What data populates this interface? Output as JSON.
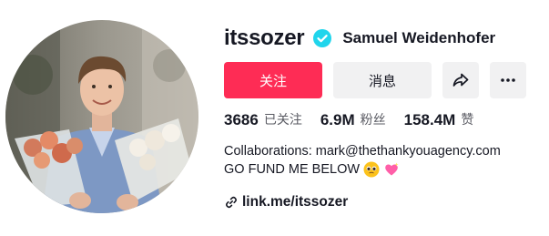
{
  "profile": {
    "username": "itssozer",
    "nickname": "Samuel Weidenhofer",
    "verified_icon": "verified-badge-icon",
    "avatar_icon": "profile-photo"
  },
  "buttons": {
    "follow_label": "关注",
    "message_label": "消息",
    "share_icon": "share-arrow-icon",
    "more_icon": "more-dots-icon"
  },
  "stats": {
    "following_count": "3686",
    "following_label": "已关注",
    "followers_count": "6.9M",
    "followers_label": "粉丝",
    "likes_count": "158.4M",
    "likes_label": "赞"
  },
  "bio": {
    "line1": "Collaborations: mark@thethankyouagency.com",
    "line2": "GO FUND ME BELOW",
    "emojis": [
      "pleading-face-emoji",
      "sparkling-heart-emoji"
    ]
  },
  "link": {
    "icon": "link-icon",
    "text": "link.me/itssozer"
  },
  "colors": {
    "accent": "#fe2c55",
    "verified": "#20d5ec",
    "button_bg": "#f1f1f2",
    "text": "#161823",
    "muted": "#5a5b63"
  }
}
